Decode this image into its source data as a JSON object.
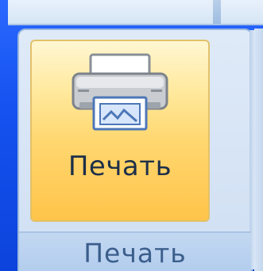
{
  "ribbon": {
    "group": {
      "caption": "Печать",
      "button": {
        "label": "Печать",
        "icon": "printer-icon"
      }
    }
  },
  "colors": {
    "background": "#1552ef",
    "button_highlight": "#ffd770",
    "ribbon": "#dfeaf8",
    "caption_text": "#3b5e8c"
  }
}
